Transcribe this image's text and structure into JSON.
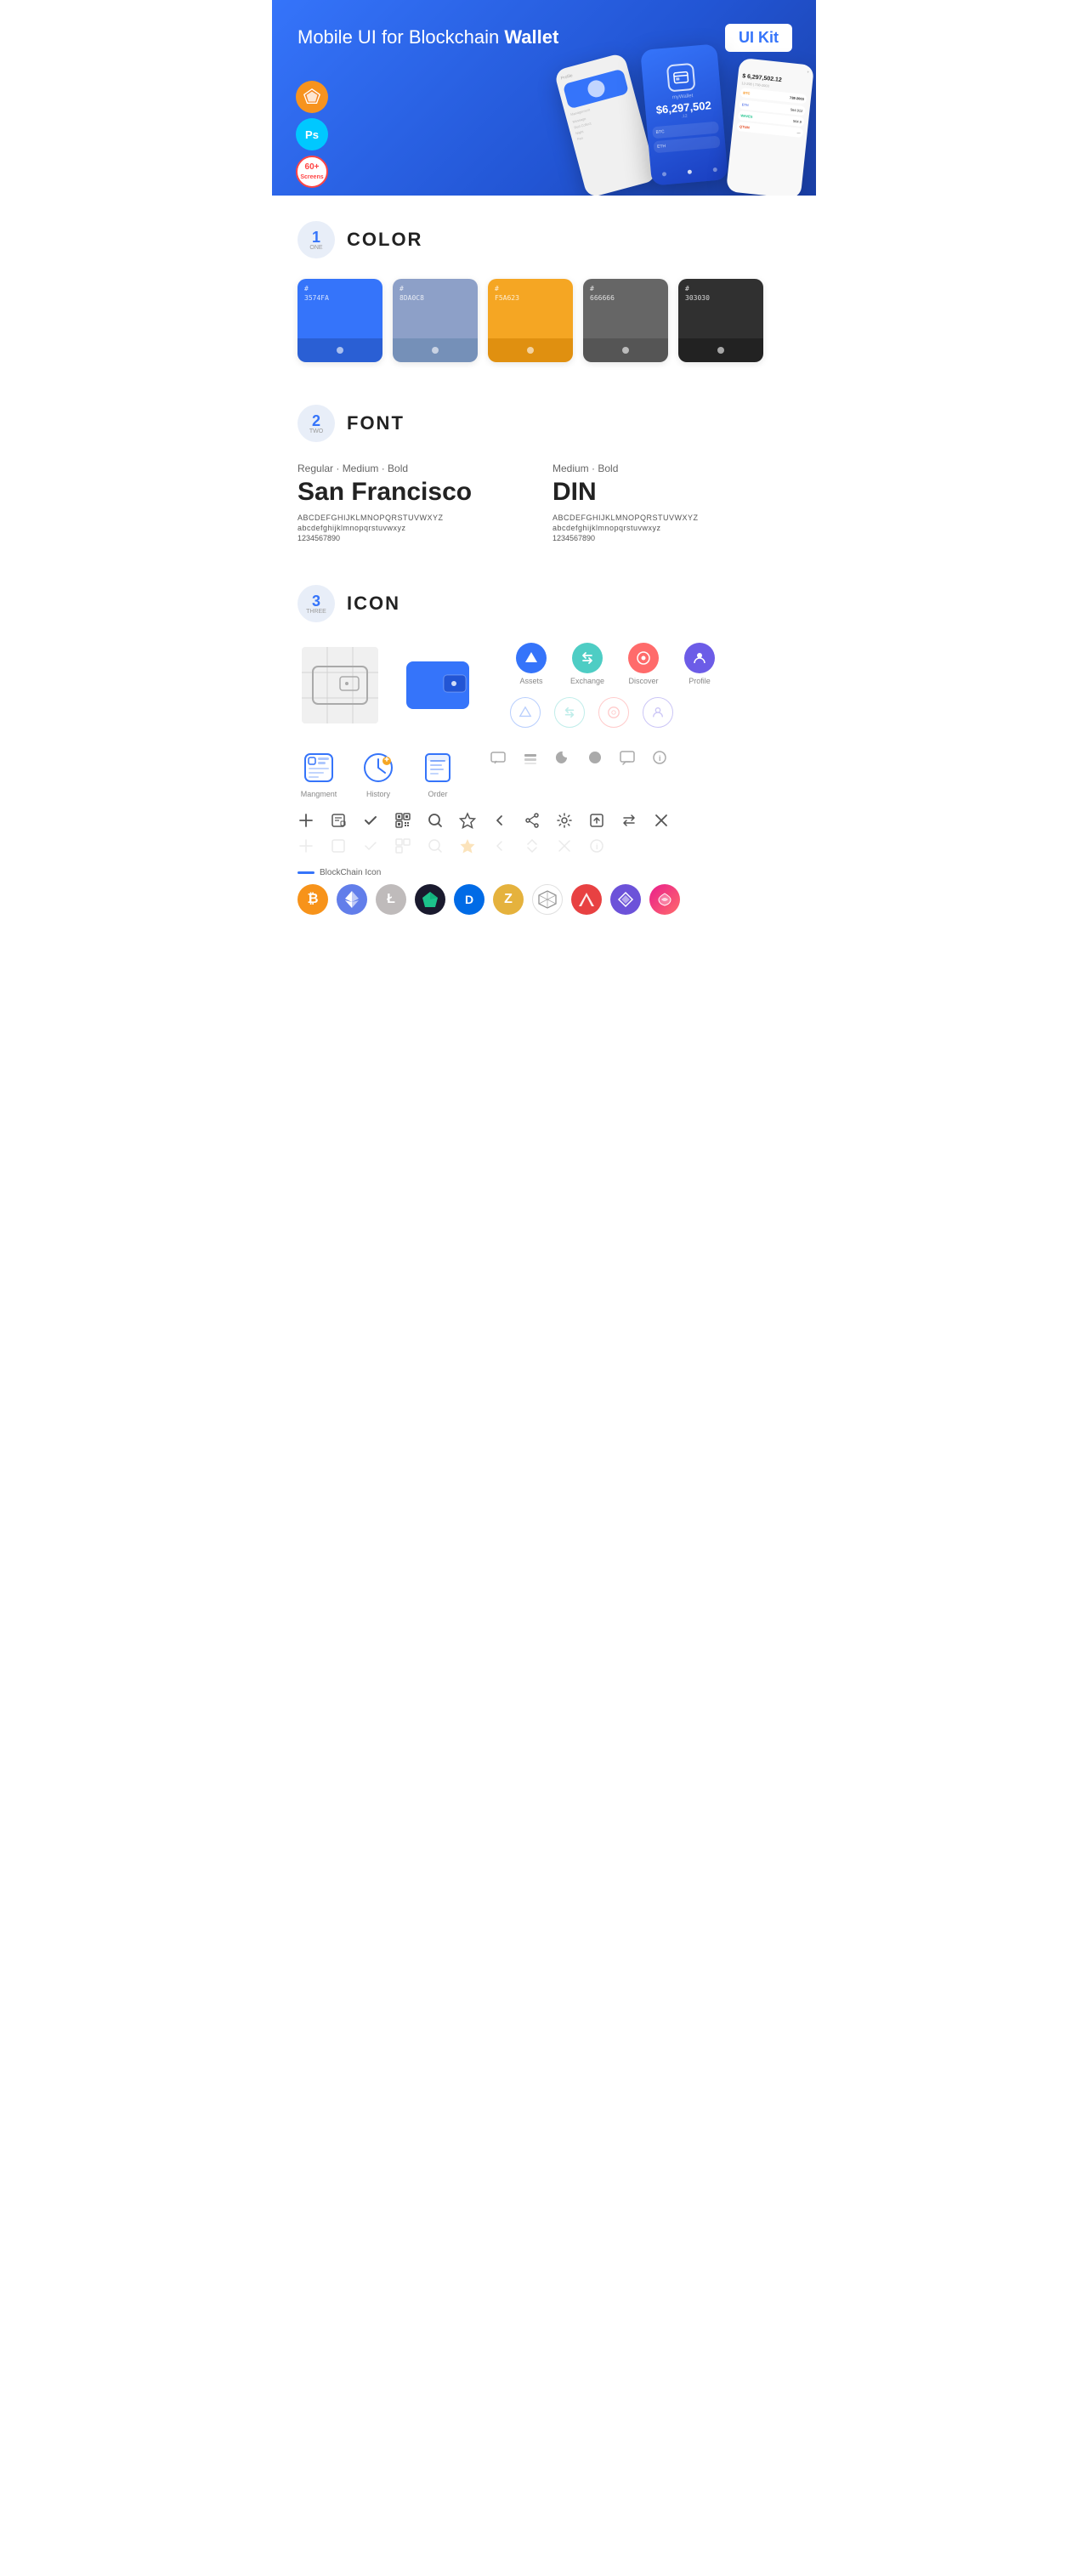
{
  "hero": {
    "title_regular": "Mobile UI for Blockchain ",
    "title_bold": "Wallet",
    "badge": "UI Kit",
    "sketch_label": "Sk",
    "ps_label": "Ps",
    "screens_label": "60+\nScreens"
  },
  "section1": {
    "number": "1",
    "word": "ONE",
    "title": "COLOR",
    "colors": [
      {
        "hex": "#3574FA",
        "label": "#\n3574FA"
      },
      {
        "hex": "#8D A0C8",
        "label": "#\n8DA0C8"
      },
      {
        "hex": "#F5A623",
        "label": "#\nF5A623"
      },
      {
        "hex": "#666666",
        "label": "#\n666666"
      },
      {
        "hex": "#303030",
        "label": "#\n303030"
      }
    ]
  },
  "section2": {
    "number": "2",
    "word": "TWO",
    "title": "FONT",
    "font1": {
      "style": "Regular · Medium · Bold",
      "name": "San Francisco",
      "upper": "ABCDEFGHIJKLMNOPQRSTUVWXYZ",
      "lower": "abcdefghijklmnopqrstuvwxyz",
      "numbers": "1234567890"
    },
    "font2": {
      "style": "Medium · Bold",
      "name": "DIN",
      "upper": "ABCDEFGHIJKLMNOPQRSTUVWXYZ",
      "lower": "abcdefghijklmnopqrstuvwxyz",
      "numbers": "1234567890"
    }
  },
  "section3": {
    "number": "3",
    "word": "THREE",
    "title": "ICON",
    "nav_icons": [
      {
        "label": "Assets"
      },
      {
        "label": "Exchange"
      },
      {
        "label": "Discover"
      },
      {
        "label": "Profile"
      }
    ],
    "app_icons": [
      {
        "label": "Mangment"
      },
      {
        "label": "History"
      },
      {
        "label": "Order"
      }
    ],
    "blockchain_label": "BlockChain Icon",
    "crypto_coins": [
      {
        "symbol": "₿",
        "color": "#F7931A",
        "bg": "#FFF3E0"
      },
      {
        "symbol": "Ξ",
        "color": "#627EEA",
        "bg": "#E8EEFF"
      },
      {
        "symbol": "Ł",
        "color": "#B8B8B8",
        "bg": "#F5F5F5"
      },
      {
        "symbol": "◆",
        "color": "#1CC28B",
        "bg": "#E3FFF5"
      },
      {
        "symbol": "D",
        "color": "#006BE6",
        "bg": "#E0F0FF"
      },
      {
        "symbol": "Z",
        "color": "#E5B23D",
        "bg": "#FFF8E1"
      },
      {
        "symbol": "⬡",
        "color": "#555",
        "bg": "#F0F0F0"
      },
      {
        "symbol": "▲",
        "color": "#E84142",
        "bg": "#FDECEA"
      },
      {
        "symbol": "◇",
        "color": "#6C52D9",
        "bg": "#EEE8FF"
      },
      {
        "symbol": "⬡",
        "color": "#E91E8C",
        "bg": "#FCE4F3"
      }
    ]
  }
}
